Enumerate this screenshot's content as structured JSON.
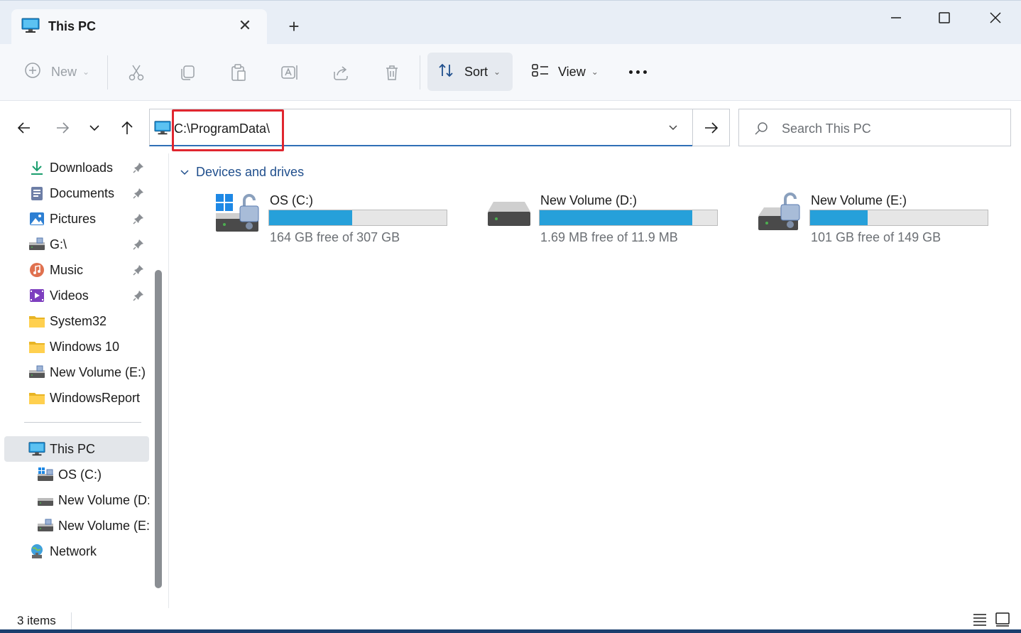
{
  "window": {
    "tab_title": "This PC",
    "tab_icon": "this-pc-icon",
    "new_tab_glyph": "+",
    "close_tab_glyph": "✕"
  },
  "toolbar": {
    "new_label": "New",
    "sort_label": "Sort",
    "view_label": "View",
    "icons": [
      "add-icon",
      "cut-icon",
      "copy-icon",
      "paste-icon",
      "rename-icon",
      "share-icon",
      "delete-icon",
      "sort-icon",
      "view-icon",
      "more-icon"
    ]
  },
  "address": {
    "path": "C:\\ProgramData\\",
    "highlight_color": "#e0262f"
  },
  "search": {
    "placeholder": "Search This PC"
  },
  "sidebar": {
    "quick_access": [
      {
        "label": "Downloads",
        "icon": "download-icon",
        "pinned": true
      },
      {
        "label": "Documents",
        "icon": "documents-icon",
        "pinned": true
      },
      {
        "label": "Pictures",
        "icon": "pictures-icon",
        "pinned": true
      },
      {
        "label": "G:\\",
        "icon": "drive-icon",
        "pinned": true
      },
      {
        "label": "Music",
        "icon": "music-icon",
        "pinned": true
      },
      {
        "label": "Videos",
        "icon": "videos-icon",
        "pinned": true
      },
      {
        "label": "System32",
        "icon": "folder-icon",
        "pinned": false
      },
      {
        "label": "Windows 10",
        "icon": "folder-icon",
        "pinned": false
      },
      {
        "label": "New Volume (E:)",
        "icon": "drive-icon",
        "pinned": false
      },
      {
        "label": "WindowsReport",
        "icon": "folder-icon",
        "pinned": false
      }
    ],
    "this_pc": {
      "label": "This PC",
      "icon": "this-pc-icon"
    },
    "drives": [
      {
        "label": "OS (C:)",
        "icon": "windows-drive-icon"
      },
      {
        "label": "New Volume (D:)",
        "icon": "drive-icon"
      },
      {
        "label": "New Volume (E:)",
        "icon": "drive-icon"
      }
    ],
    "network": {
      "label": "Network",
      "icon": "network-icon"
    }
  },
  "content": {
    "group_title": "Devices and drives",
    "drives": [
      {
        "name": "OS (C:)",
        "free_text": "164 GB free of 307 GB",
        "used_fraction": 0.466,
        "icon": "windows-locked-drive-icon"
      },
      {
        "name": "New Volume (D:)",
        "free_text": "1.69 MB free of 11.9 MB",
        "used_fraction": 0.858,
        "icon": "drive-icon"
      },
      {
        "name": "New Volume (E:)",
        "free_text": "101 GB free of 149 GB",
        "used_fraction": 0.322,
        "icon": "locked-drive-icon"
      }
    ],
    "bar_color": "#26a0da"
  },
  "status": {
    "items_text": "3 items"
  }
}
